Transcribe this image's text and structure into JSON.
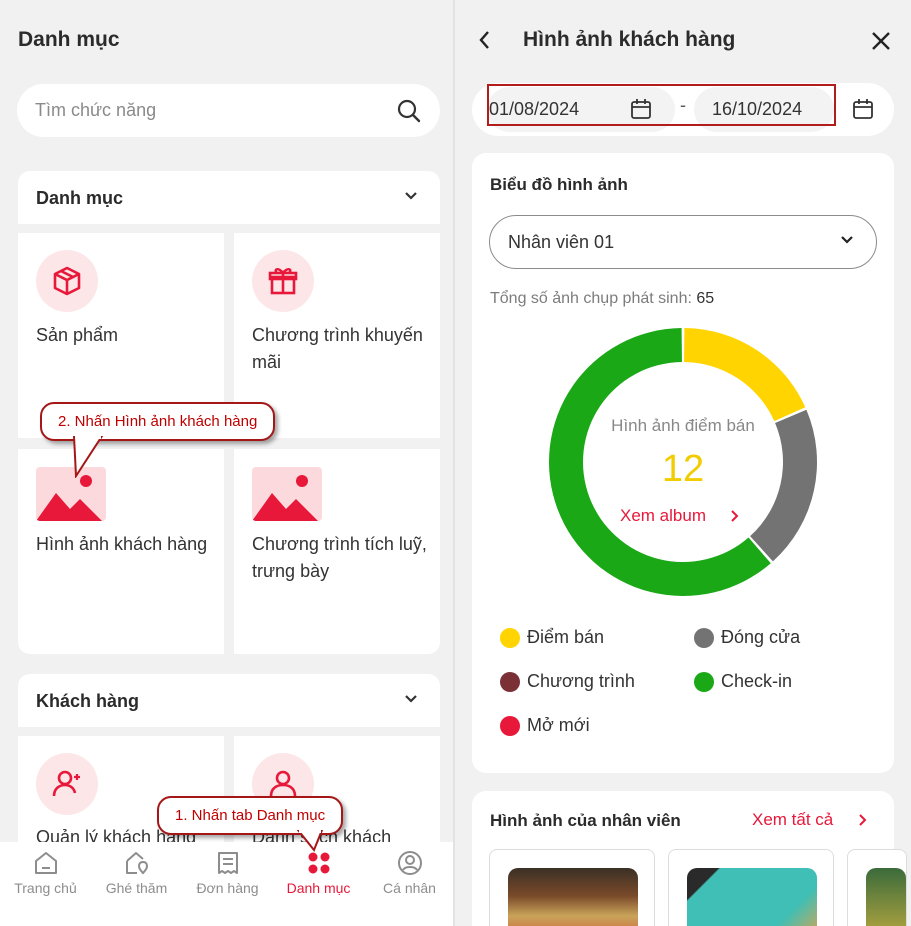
{
  "left": {
    "title": "Danh mục",
    "search_placeholder": "Tìm chức năng",
    "section1": {
      "title": "Danh mục",
      "tiles": [
        "Sản phẩm",
        "Chương trình khuyến mãi",
        "Hình ảnh khách hàng",
        "Chương trình tích luỹ, trưng bày"
      ]
    },
    "section2": {
      "title": "Khách hàng",
      "tiles": [
        "Quản lý khách hàng",
        "Danh sách khách"
      ]
    },
    "callout_step2": "2. Nhấn Hình ảnh khách hàng",
    "callout_step1": "1. Nhấn tab Danh mục",
    "nav": [
      {
        "label": "Trang chủ",
        "icon": "home-icon"
      },
      {
        "label": "Ghé thăm",
        "icon": "visit-icon"
      },
      {
        "label": "Đơn hàng",
        "icon": "order-icon"
      },
      {
        "label": "Danh mục",
        "icon": "category-icon",
        "active": true
      },
      {
        "label": "Cá nhân",
        "icon": "profile-icon"
      }
    ]
  },
  "right": {
    "title": "Hình ảnh khách hàng",
    "date_from": "01/08/2024",
    "date_sep": "-",
    "date_to": "16/10/2024",
    "chart_card": {
      "title": "Biểu đồ hình ảnh",
      "employee_select": "Nhân viên 01",
      "total_label": "Tổng số ảnh chụp phát sinh:",
      "total_value": "65",
      "center_label": "Hình ảnh điểm bán",
      "center_value": "12",
      "album_link": "Xem album"
    },
    "staff_card": {
      "title": "Hình ảnh của nhân viên",
      "see_all": "Xem tất cả"
    }
  },
  "colors": {
    "accent": "#e8183a",
    "diem_ban": "#ffd400",
    "dong_cua": "#737373",
    "chuong_trinh": "#7b3036",
    "check_in": "#1aa816",
    "mo_moi": "#e8183a"
  },
  "chart_data": {
    "type": "pie",
    "title": "Biểu đồ hình ảnh",
    "categories": [
      "Điểm bán",
      "Đóng cửa",
      "Chương trình",
      "Check-in",
      "Mở mới"
    ],
    "values": [
      12,
      13,
      0,
      40,
      0
    ],
    "colors": [
      "#ffd400",
      "#737373",
      "#7b3036",
      "#1aa816",
      "#e8183a"
    ],
    "legend": "bottom"
  }
}
